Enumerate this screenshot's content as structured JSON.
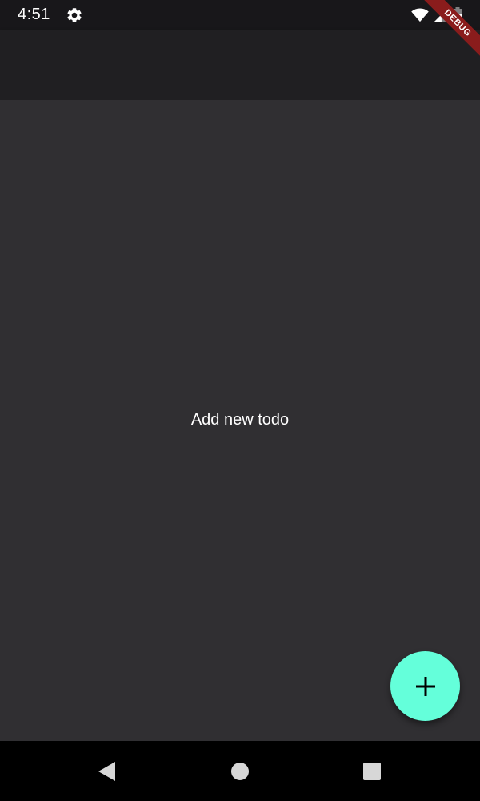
{
  "status_bar": {
    "time": "4:51",
    "left_icons": [
      "settings-gear-icon"
    ],
    "right_icons": [
      "wifi-icon",
      "cell-signal-icon",
      "battery-icon"
    ]
  },
  "app_bar": {
    "title": ""
  },
  "main": {
    "empty_message": "Add new todo"
  },
  "fab": {
    "icon": "plus-icon",
    "color": "#64FFDA"
  },
  "nav_bar": {
    "buttons": [
      "back-icon",
      "home-icon",
      "recents-icon"
    ]
  },
  "debug_banner": {
    "label": "DEBUG",
    "color": "#8A1C1C"
  },
  "colors": {
    "status_bar_bg": "#18171A",
    "app_bar_bg": "#201F22",
    "body_bg": "#302F32",
    "nav_bar_bg": "#000000"
  }
}
